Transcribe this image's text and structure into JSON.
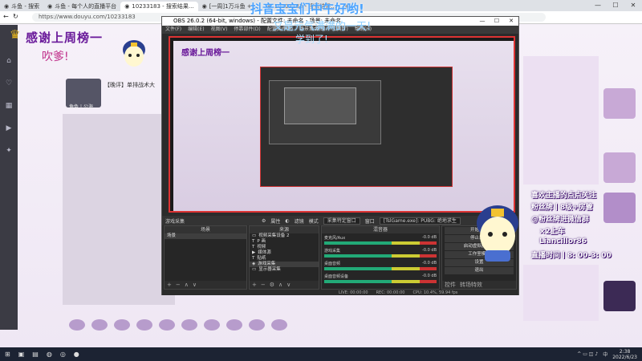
{
  "browser": {
    "tabs": [
      {
        "label": "斗鱼 - 搜索",
        "active": false
      },
      {
        "label": "斗鱼 - 每个人的直播平台",
        "active": false
      },
      {
        "label": "10233183 - 搜索结果...",
        "active": true
      },
      {
        "label": "[一周]1万斗鱼 + ...",
        "active": false
      },
      {
        "label": "10233183 - 搜索结果...",
        "active": false
      }
    ],
    "url": "https://www.douyu.com/10233183",
    "win_minimize": "—",
    "win_maximize": "☐",
    "win_close": "✕"
  },
  "page": {
    "banner_text": "感谢上周榜一",
    "chuiyo_text": "吹爹!",
    "stream_title": "【晚评】单排战术大",
    "streamer_name": "角色丨公海"
  },
  "obs": {
    "title": "OBS 26.0.2 (64-bit, windows) - 配置文件: 未命名 - 场景: 未命名",
    "menu": [
      "文件(F)",
      "编辑(E)",
      "视图(V)",
      "停靠部件(D)",
      "配置文件(P)",
      "场景集合(S)",
      "工具(T)",
      "帮助(H)"
    ],
    "toolbar": {
      "source_label": "游戏采集",
      "properties": "属性",
      "filters": "滤镜",
      "mode_label": "模式",
      "mode_value": "采集特定窗口",
      "window_label": "窗口",
      "window_value": "[TslGame.exe]: PUBG: 绝地求生"
    },
    "scenes": {
      "header": "场景",
      "items": [
        "场景"
      ]
    },
    "sources": {
      "header": "来源",
      "items": [
        "视频采集设备 2",
        "P 画",
        "视频",
        "媒体源",
        "贴纸",
        "游戏采集",
        "显示器采集"
      ]
    },
    "mixer": {
      "header": "混音器",
      "channels": [
        {
          "name": "麦克风/Aux",
          "level": "-0.0 dB"
        },
        {
          "name": "游戏采集",
          "level": "-0.0 dB"
        },
        {
          "name": "桌面音频",
          "level": "-0.0 dB"
        },
        {
          "name": "桌面音频设备",
          "level": "-0.0 dB"
        }
      ]
    },
    "controls": [
      "开始推流",
      "停止录制",
      "启动虚拟摄像机",
      "工作室模式",
      "设置",
      "退出"
    ],
    "controls_tabs": [
      "控件",
      "转场特效"
    ],
    "status": {
      "live": "LIVE: 00:00:00",
      "rec": "REC: 00:00:00",
      "cpu": "CPU: 10.4%, 59.94 fps"
    }
  },
  "overlay": {
    "danmu": [
      "抖音宝宝们中午好哟!",
      "又是元气满满的一天!",
      "学到了!"
    ],
    "info": [
      "喜欢主播的点点关注",
      "粉丝牌丨8级+房管",
      "@粉丝牌进微信群",
      "×2上车",
      "Liancillor86",
      "直播时间丨8: 00-3: 00"
    ]
  },
  "taskbar": {
    "time": "2:38",
    "date": "2022/6/23",
    "lang": "中",
    "tray": "^ ▭ ◫ ♪"
  },
  "colors": {
    "accent": "#6a1a9a",
    "obs_red": "#dd3333",
    "info_text": "#ffffff"
  }
}
